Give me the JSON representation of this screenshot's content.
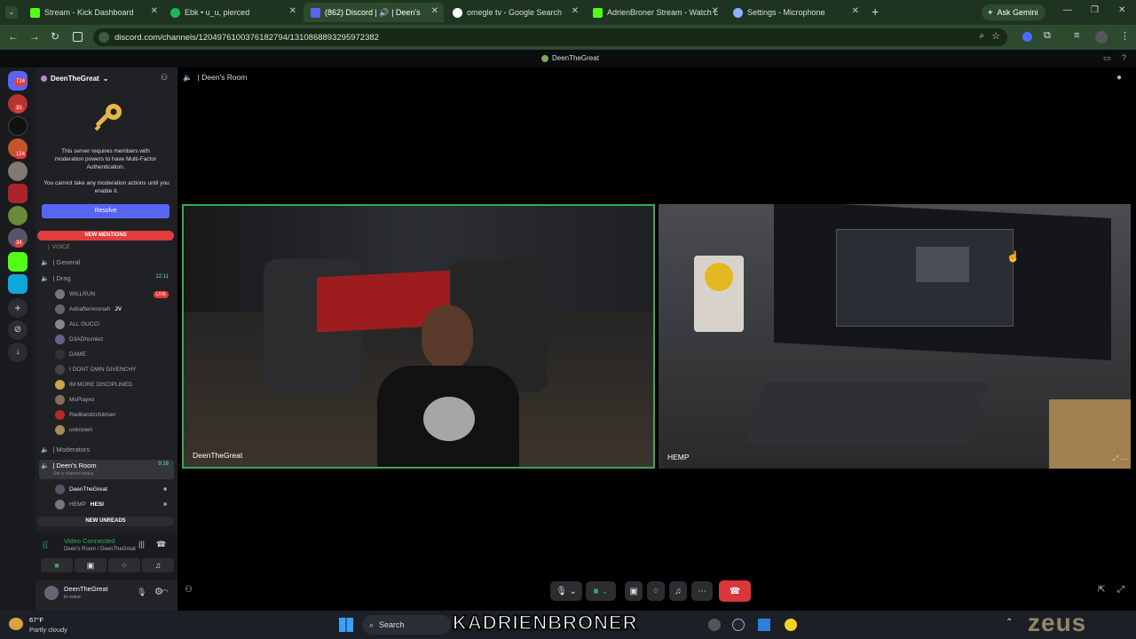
{
  "browser": {
    "tabs": [
      {
        "label": "Stream - Kick Dashboard",
        "color": "#53fc18"
      },
      {
        "label": "Ebk • u_u, pierced",
        "color": "#1db954"
      },
      {
        "label": "(862) Discord | 🔊 | Deen's",
        "color": "#5865f2",
        "active": true
      },
      {
        "label": "omegle tv - Google Search",
        "color": "#ffffff"
      },
      {
        "label": "AdrienBroner Stream - Watch L",
        "color": "#53fc18"
      },
      {
        "label": "Settings - Microphone",
        "color": "#8ab4f8"
      }
    ],
    "new_tab": "+",
    "ask_gemini": "Ask Gemini",
    "url": "discord.com/channels/1204976100376182794/1310868893295972382"
  },
  "discord": {
    "title": "DeenTheGreat",
    "voice_header": "| Deen's Room",
    "rail_badges": [
      "724",
      "31",
      "154",
      "34"
    ],
    "server_name": "DeenTheGreat",
    "mfa_notice": "This server requires members with moderation powers to have Multi-Factor Authentication.",
    "mfa_sub": "You cannot take any moderation actions until you enable it.",
    "resolve": "Resolve",
    "new_mentions": "NEW MENTIONS",
    "voice_category": "VOICE",
    "channels": {
      "general": "| General",
      "drag": "| Drag",
      "drag_time": "12:11",
      "moderators": "| Moderators",
      "deens_room": "| Deen's Room",
      "deens_room_time": "9:16",
      "channel_status": "Set a channel status"
    },
    "drag_members": [
      {
        "name": "WILLRUN",
        "live": "LIVE"
      },
      {
        "name": "Adoafternoonah",
        "tag": "JV"
      },
      {
        "name": "ALL GUCCI"
      },
      {
        "name": "D3ADhomiez"
      },
      {
        "name": "DAME"
      },
      {
        "name": "I DONT OWN GIVENCHY"
      },
      {
        "name": "IM MORE DISCIPLINED"
      },
      {
        "name": "MsPlayxo"
      },
      {
        "name": "Redbandzchitman"
      },
      {
        "name": "unknown"
      }
    ],
    "room_members": [
      {
        "name": "DeenTheGreat"
      },
      {
        "name": "HEMP",
        "tag": "HESI"
      }
    ],
    "new_unreads": "NEW UNREADS",
    "voice_status": "Video Connected",
    "voice_path": "Deen's Room / DeenTheGreat",
    "user_name": "DeenTheGreat",
    "user_status": "In voice",
    "tiles": [
      {
        "name": "DeenTheGreat"
      },
      {
        "name": "HEMP"
      }
    ]
  },
  "taskbar": {
    "weather_temp": "67°F",
    "weather_desc": "Partly cloudy",
    "search": "Search",
    "overlay": "KADRIENBRONER",
    "watermark": "zeus"
  }
}
